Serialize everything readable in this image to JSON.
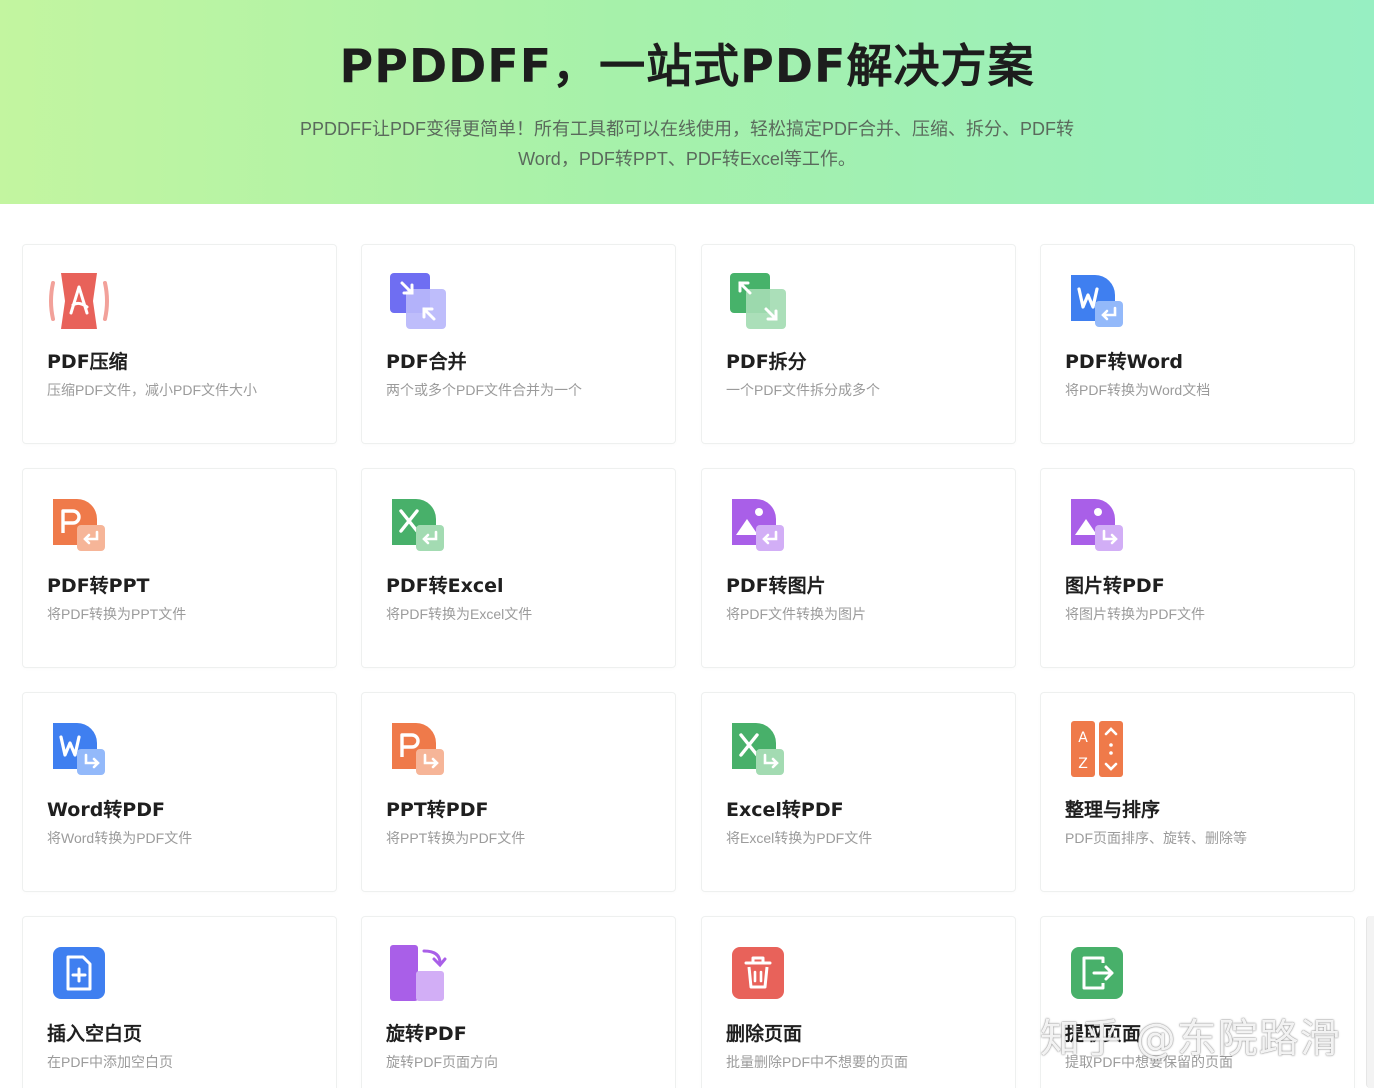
{
  "hero": {
    "title": "PPDDFF，一站式PDF解决方案",
    "description": "PPDDFF让PDF变得更简单！所有工具都可以在线使用，轻松搞定PDF合并、压缩、拆分、PDF转Word，PDF转PPT、PDF转Excel等工作。"
  },
  "tools": [
    {
      "title": "PDF压缩",
      "desc": "压缩PDF文件，减小PDF文件大小",
      "icon": "compress-icon",
      "color": "#e8625a"
    },
    {
      "title": "PDF合并",
      "desc": "两个或多个PDF文件合并为一个",
      "icon": "merge-icon",
      "color": "#6f6ef2"
    },
    {
      "title": "PDF拆分",
      "desc": "一个PDF文件拆分成多个",
      "icon": "split-icon",
      "color": "#47b26a"
    },
    {
      "title": "PDF转Word",
      "desc": "将PDF转换为Word文档",
      "icon": "word-icon",
      "color": "#3f7ff0"
    },
    {
      "title": "PDF转PPT",
      "desc": "将PDF转换为PPT文件",
      "icon": "ppt-icon",
      "color": "#ef7a4a"
    },
    {
      "title": "PDF转Excel",
      "desc": "将PDF转换为Excel文件",
      "icon": "excel-icon",
      "color": "#48b06a"
    },
    {
      "title": "PDF转图片",
      "desc": "将PDF文件转换为图片",
      "icon": "image-icon",
      "color": "#a95fe8"
    },
    {
      "title": "图片转PDF",
      "desc": "将图片转换为PDF文件",
      "icon": "image-to-pdf-icon",
      "color": "#a95fe8"
    },
    {
      "title": "Word转PDF",
      "desc": "将Word转换为PDF文件",
      "icon": "word-to-pdf-icon",
      "color": "#3f7ff0"
    },
    {
      "title": "PPT转PDF",
      "desc": "将PPT转换为PDF文件",
      "icon": "ppt-to-pdf-icon",
      "color": "#ef7a4a"
    },
    {
      "title": "Excel转PDF",
      "desc": "将Excel转换为PDF文件",
      "icon": "excel-to-pdf-icon",
      "color": "#48b06a"
    },
    {
      "title": "整理与排序",
      "desc": "PDF页面排序、旋转、删除等",
      "icon": "sort-icon",
      "color": "#ef7a4a"
    },
    {
      "title": "插入空白页",
      "desc": "在PDF中添加空白页",
      "icon": "insert-page-icon",
      "color": "#3f7ff0"
    },
    {
      "title": "旋转PDF",
      "desc": "旋转PDF页面方向",
      "icon": "rotate-icon",
      "color": "#a95fe8"
    },
    {
      "title": "删除页面",
      "desc": "批量删除PDF中不想要的页面",
      "icon": "delete-icon",
      "color": "#e8625a"
    },
    {
      "title": "提取页面",
      "desc": "提取PDF中想要保留的页面",
      "icon": "extract-icon",
      "color": "#48b06a"
    }
  ],
  "watermark": "知乎 @东院路滑"
}
